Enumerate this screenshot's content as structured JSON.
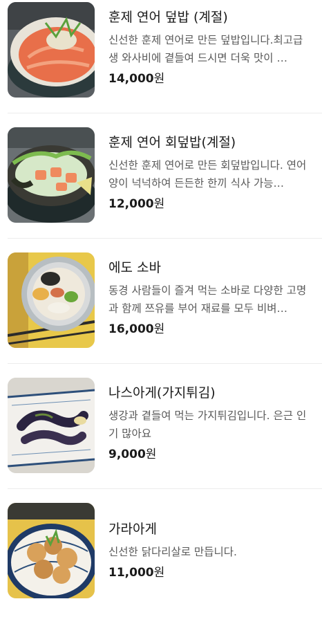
{
  "menu": {
    "items": [
      {
        "name": "훈제 연어 덮밥 (계절)",
        "description": "신선한 훈제 연어로 만든 덮밥입니다.최고급 생 와사비에 곁들여 드시면 더욱 맛이 …",
        "price": "14,000",
        "unit": "원",
        "thumb_icon": "salmon-rice-bowl-photo"
      },
      {
        "name": "훈제 연어 회덮밥(계절)",
        "description": "신선한 훈제 연어로 만든 회덮밥입니다. 연어 양이 넉넉하여 든든한 한끼 식사 가능…",
        "price": "12,000",
        "unit": "원",
        "thumb_icon": "salmon-sashimi-bowl-photo"
      },
      {
        "name": "에도 소바",
        "description": "동경 사람들이 즐겨 먹는 소바로 다양한 고명과 함께 쯔유를 부어 재료를 모두 비벼…",
        "price": "16,000",
        "unit": "원",
        "thumb_icon": "soba-photo"
      },
      {
        "name": "나스아게(가지튀김)",
        "description": "생강과 곁들여 먹는 가지튀김입니다. 은근 인기 많아요",
        "price": "9,000",
        "unit": "원",
        "thumb_icon": "fried-eggplant-photo"
      },
      {
        "name": "가라아게",
        "description": "신선한 닭다리살로 만듭니다.",
        "price": "11,000",
        "unit": "원",
        "thumb_icon": "karaage-photo"
      }
    ]
  },
  "colors": {
    "title": "#1a1a1a",
    "description": "#595959",
    "divider": "#ececec"
  }
}
